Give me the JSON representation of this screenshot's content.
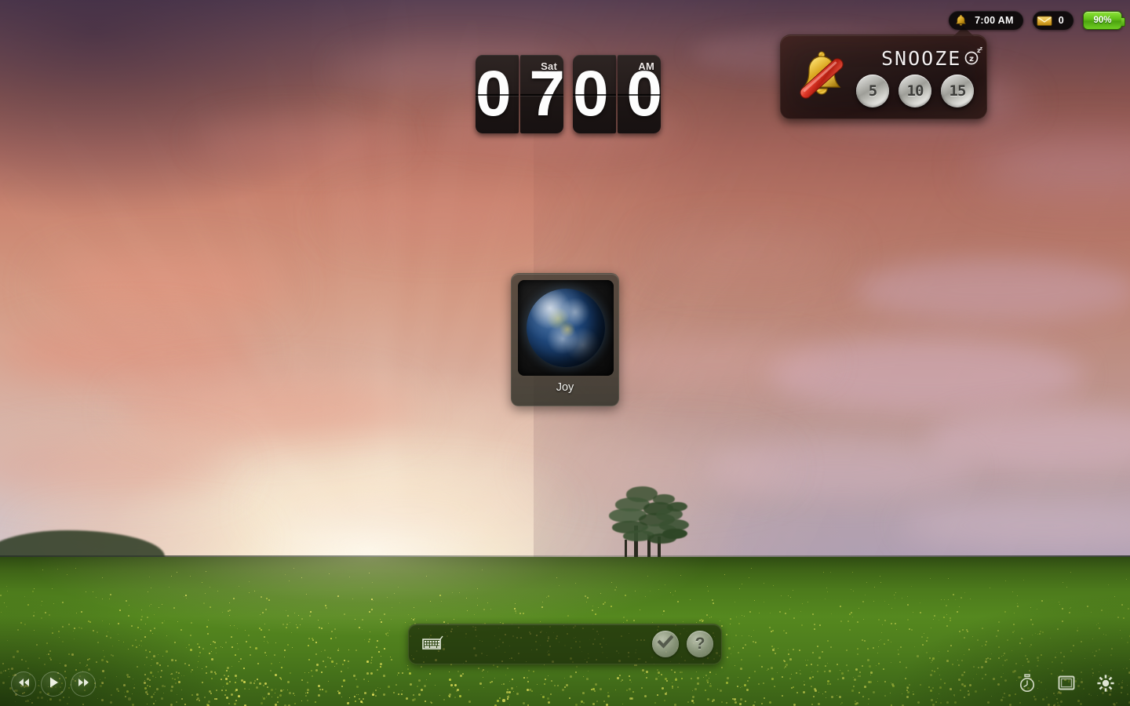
{
  "wallpaper": {
    "description": "sunset-field-wallpaper"
  },
  "statusbar": {
    "alarm": {
      "icon": "bell-icon",
      "time": "7:00 AM"
    },
    "mail": {
      "icon": "envelope-icon",
      "count": "0"
    },
    "battery": {
      "icon": "battery-icon",
      "level": "90%",
      "color": "#62c018"
    }
  },
  "clock": {
    "hours": [
      "0",
      "7"
    ],
    "minutes": [
      "0",
      "0"
    ],
    "day": "Sat",
    "meridiem": "AM"
  },
  "snooze": {
    "title": "SNOOZE",
    "zzz_icon": "zzz-icon",
    "bell_icon": "bell-off-icon",
    "buttons": [
      {
        "label": "5"
      },
      {
        "label": "10"
      },
      {
        "label": "15"
      }
    ]
  },
  "user": {
    "name": "Joy",
    "avatar_icon": "earth-avatar"
  },
  "password_bar": {
    "keyboard_icon": "keyboard-icon",
    "value": "",
    "placeholder": "",
    "submit_icon": "checkmark-icon",
    "help_icon": "question-mark-icon"
  },
  "media_controls": [
    {
      "name": "previous",
      "icon": "previous-track-icon"
    },
    {
      "name": "play",
      "icon": "play-icon"
    },
    {
      "name": "next",
      "icon": "next-track-icon"
    }
  ],
  "system_controls": [
    {
      "name": "timer",
      "icon": "stopwatch-icon"
    },
    {
      "name": "display",
      "icon": "monitor-icon"
    },
    {
      "name": "brightness",
      "icon": "brightness-icon"
    }
  ]
}
